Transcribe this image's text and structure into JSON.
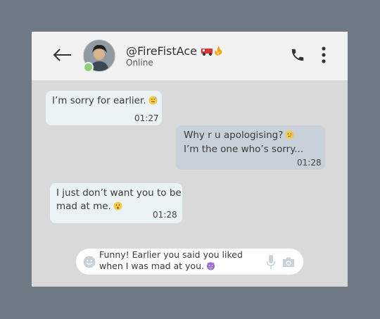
{
  "header": {
    "username": "@FireFistAce",
    "status": "Online"
  },
  "messages": [
    {
      "direction": "in",
      "line1": "I’m sorry for earlier.",
      "line2": "",
      "time": "01:27"
    },
    {
      "direction": "out",
      "line1": "Why r u apologising?",
      "line2": "I’m the one who’s sorry...",
      "time": "01:28"
    },
    {
      "direction": "in",
      "line1": "I just don’t want you to be",
      "line2": "mad at me.",
      "time": "01:28"
    }
  ],
  "composer": {
    "line1": "Funny! Earlier you said you liked",
    "line2": "when I was mad at you."
  },
  "icons": {
    "back": "left-arrow-icon",
    "call": "phone-icon",
    "menu": "vertical-dots-icon",
    "emoji": "smiley-icon",
    "mic": "microphone-icon",
    "camera": "camera-icon"
  },
  "colors": {
    "background": "#6f7a84",
    "chat_area": "#d9d9d9",
    "header": "#f2f2f2",
    "incoming_bubble": "#ebf2f4",
    "outgoing_bubble": "#c8d1da",
    "online": "#8ed07a"
  }
}
